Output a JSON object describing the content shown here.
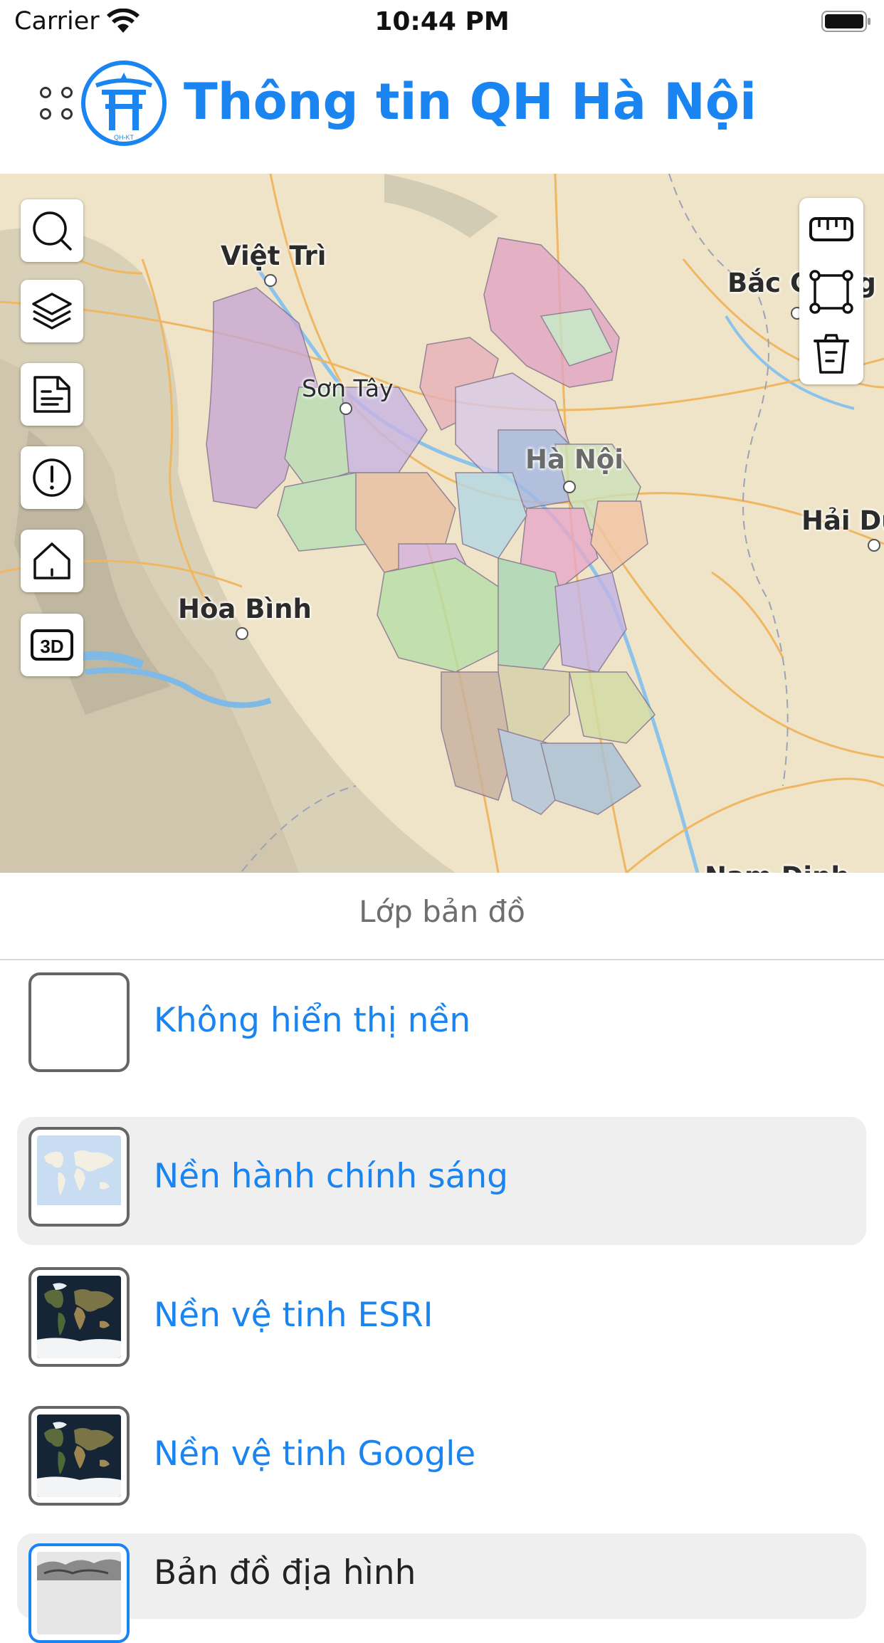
{
  "status_bar": {
    "carrier": "Carrier",
    "time": "10:44 PM"
  },
  "header": {
    "title": "Thông tin QH Hà Nội",
    "logo_text": "QH-KT"
  },
  "map": {
    "places": [
      {
        "name": "Việt Trì"
      },
      {
        "name": "Bắc Giang"
      },
      {
        "name": "Sơn Tây"
      },
      {
        "name": "Hà Nội"
      },
      {
        "name": "Hải Dương"
      },
      {
        "name": "Hòa Bình"
      },
      {
        "name": "Nam Định"
      }
    ],
    "left_tools": [
      "search-icon",
      "layers-icon",
      "document-icon",
      "alert-icon",
      "home-icon",
      "3d-icon"
    ],
    "right_tools": [
      "ruler-icon",
      "area-select-icon",
      "trash-icon"
    ],
    "tool_3d_label": "3D"
  },
  "panel": {
    "title": "Lớp bản đồ",
    "layers": [
      {
        "label": "Không hiển thị nền",
        "selected": false
      },
      {
        "label": "Nền hành chính sáng",
        "selected": true
      },
      {
        "label": "Nền vệ tinh ESRI",
        "selected": false
      },
      {
        "label": "Nền vệ tinh Google",
        "selected": false
      },
      {
        "label": "Bản đồ địa hình",
        "selected": false
      }
    ]
  },
  "colors": {
    "accent": "#1a84f0",
    "selected_row": "#efefef"
  }
}
